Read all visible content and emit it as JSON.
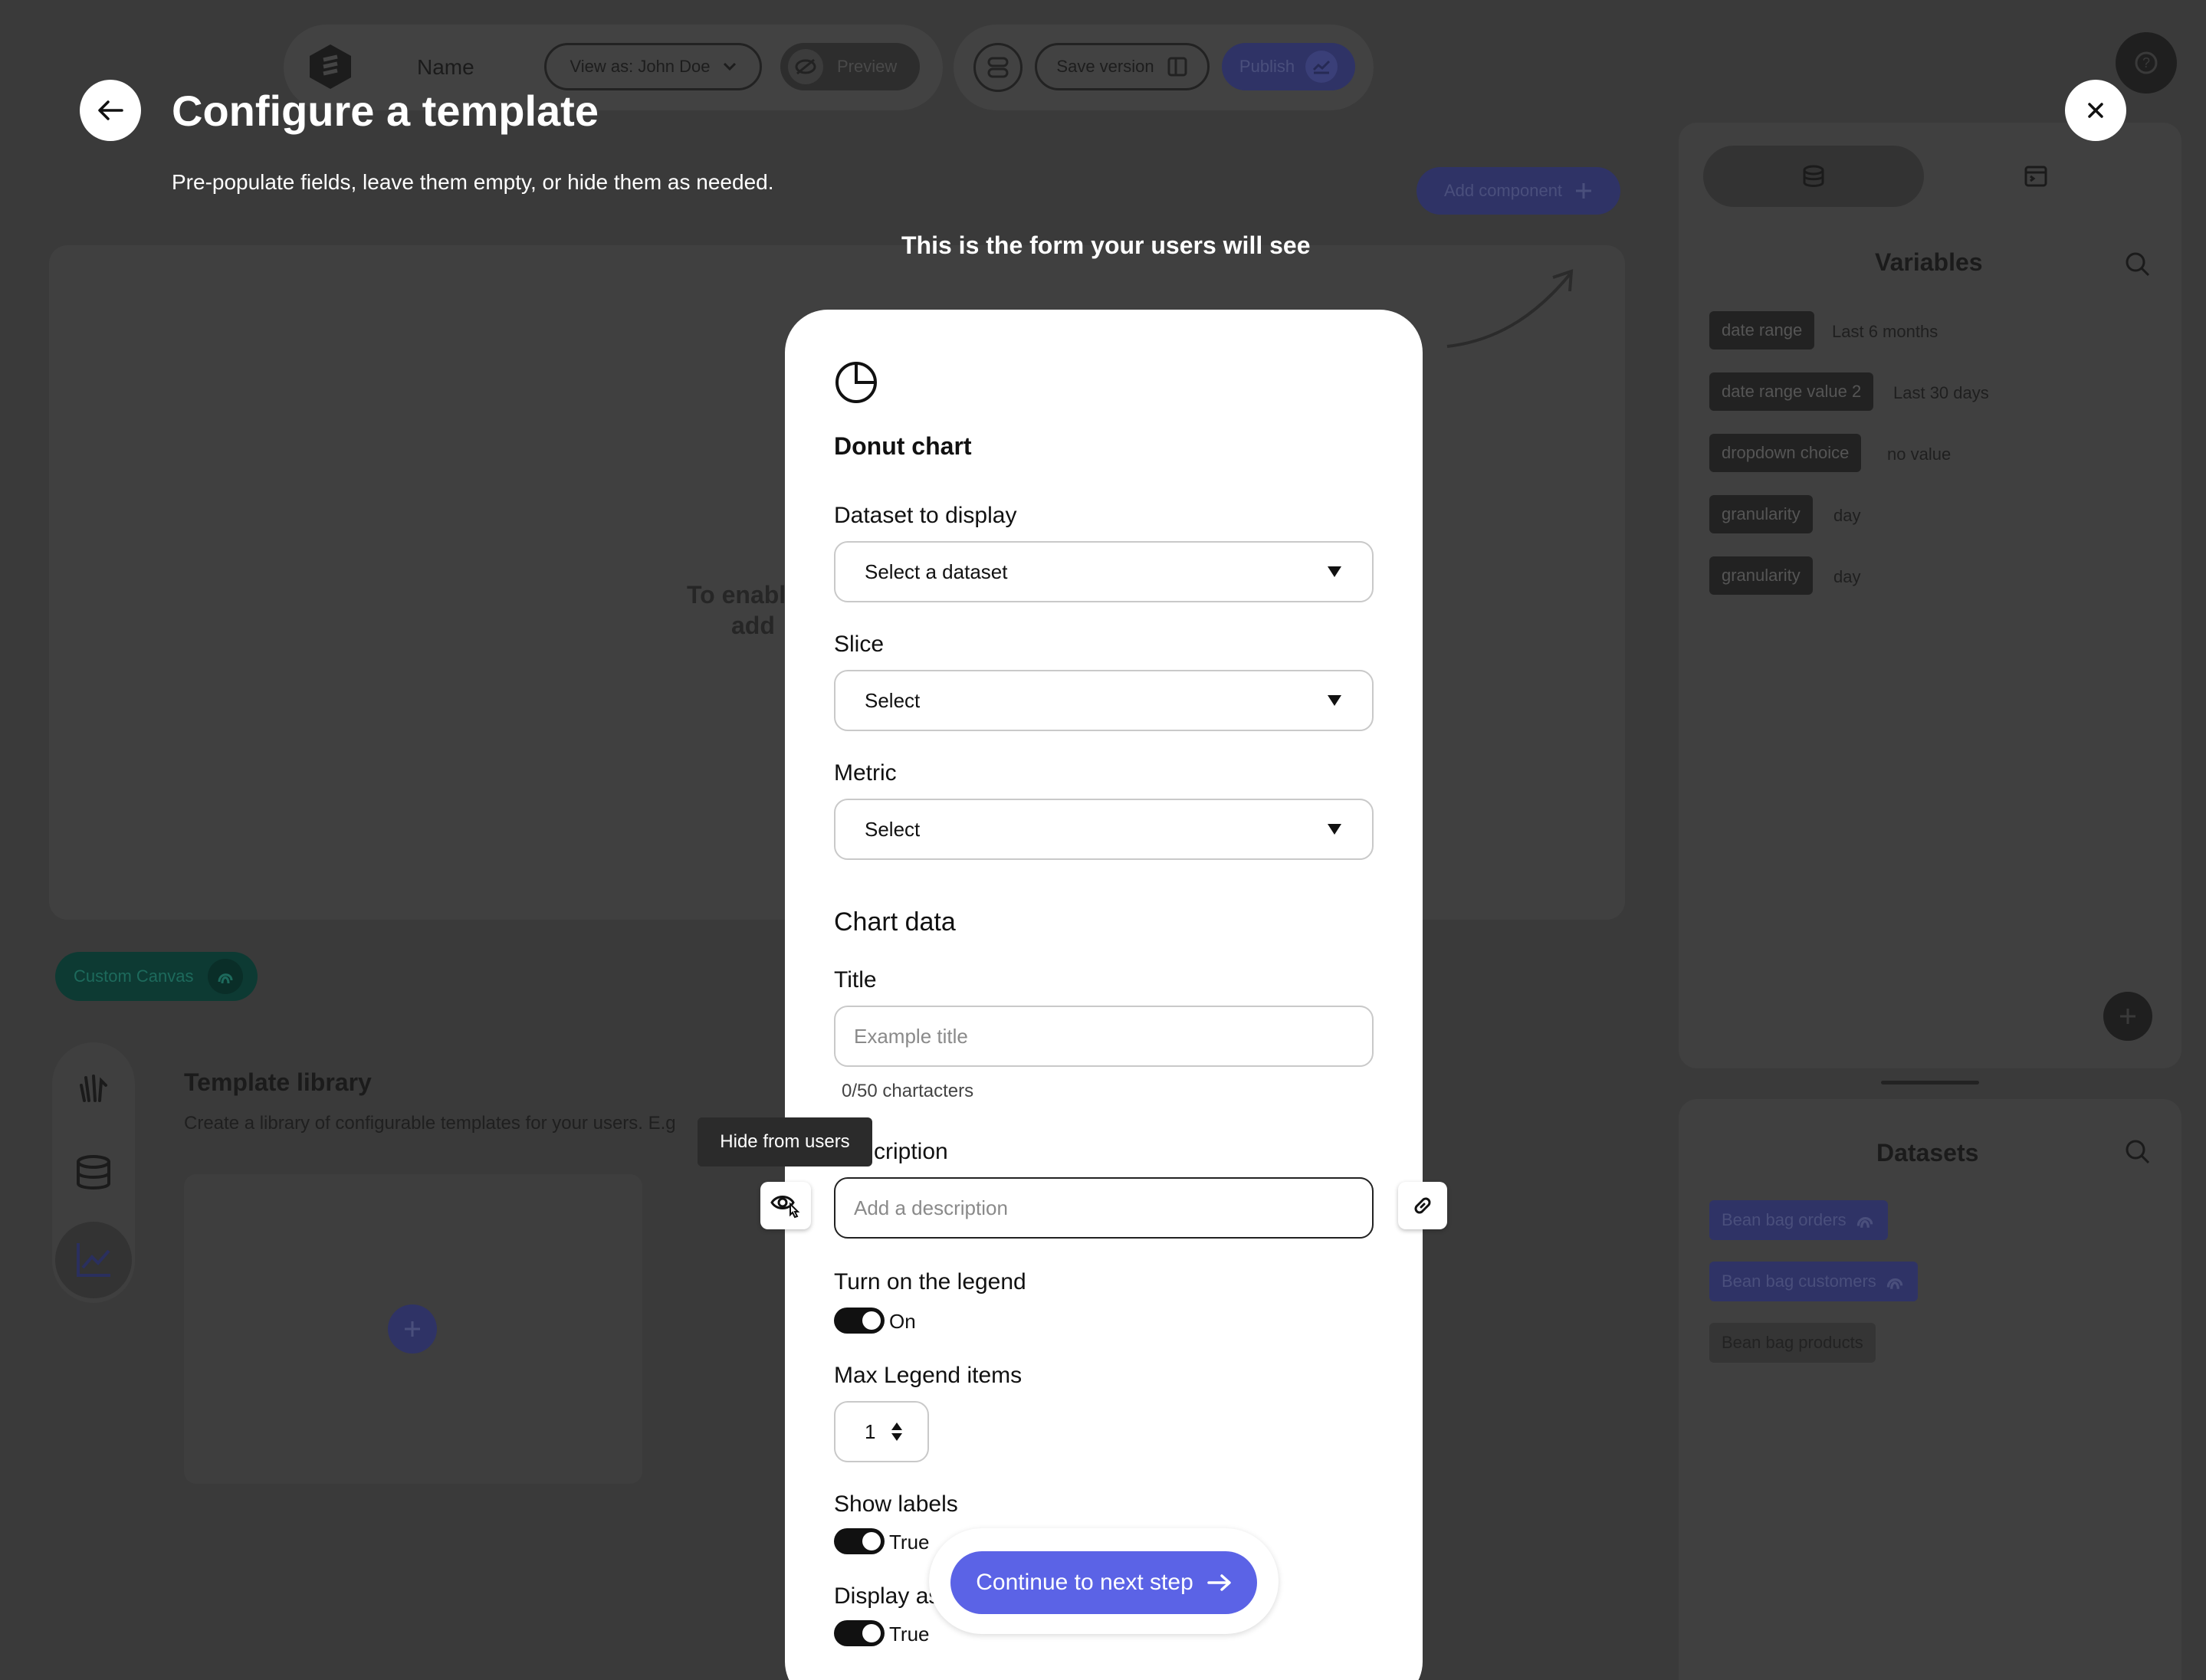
{
  "app": {
    "name_label": "Name",
    "view_as": "View as: John Doe",
    "preview_label": "Preview",
    "save_version_label": "Save version",
    "publish_label": "Publish",
    "add_component_label": "Add component",
    "canvas_hint_line1": "To enabl",
    "canvas_hint_line2": "add",
    "custom_canvas_label": "Custom Canvas",
    "template_library_title": "Template library",
    "template_library_desc": "Create a library of configurable templates for your users. E.g"
  },
  "variables_panel": {
    "title": "Variables",
    "items": [
      {
        "name": "date range",
        "value": "Last 6 months"
      },
      {
        "name": "date range value 2",
        "value": "Last 30 days"
      },
      {
        "name": "dropdown choice",
        "value": "no value"
      },
      {
        "name": "granularity",
        "value": "day"
      },
      {
        "name": "granularity",
        "value": "day"
      }
    ]
  },
  "datasets_panel": {
    "title": "Datasets",
    "items": [
      "Bean bag orders",
      "Bean bag customers",
      "Bean bag products"
    ]
  },
  "overlay": {
    "title": "Configure a template",
    "subtitle": "Pre-populate fields, leave them empty, or hide them as needed.",
    "form_hint": "This is the form your users will see"
  },
  "form": {
    "component_name": "Donut chart",
    "dataset_label": "Dataset to display",
    "dataset_value": "Select a dataset",
    "slice_label": "Slice",
    "slice_value": "Select",
    "metric_label": "Metric",
    "metric_value": "Select",
    "chart_data_heading": "Chart data",
    "title_label": "Title",
    "title_placeholder": "Example title",
    "title_counter": "0/50 chartacters",
    "description_label": "Description",
    "description_label_visible": "cription",
    "description_placeholder": "Add a description",
    "legend_label": "Turn on the legend",
    "legend_state": "On",
    "max_legend_label": "Max Legend items",
    "max_legend_value": "1",
    "show_labels_label": "Show labels",
    "show_labels_state": "True",
    "display_as_label_visible": "Display as",
    "display_as_state": "True",
    "tooltip": "Hide from users",
    "continue_label": "Continue to next step"
  },
  "colors": {
    "accent": "#5b63e6",
    "overlay_bg": "#3a3a3a",
    "toggle_on": "#111111"
  }
}
